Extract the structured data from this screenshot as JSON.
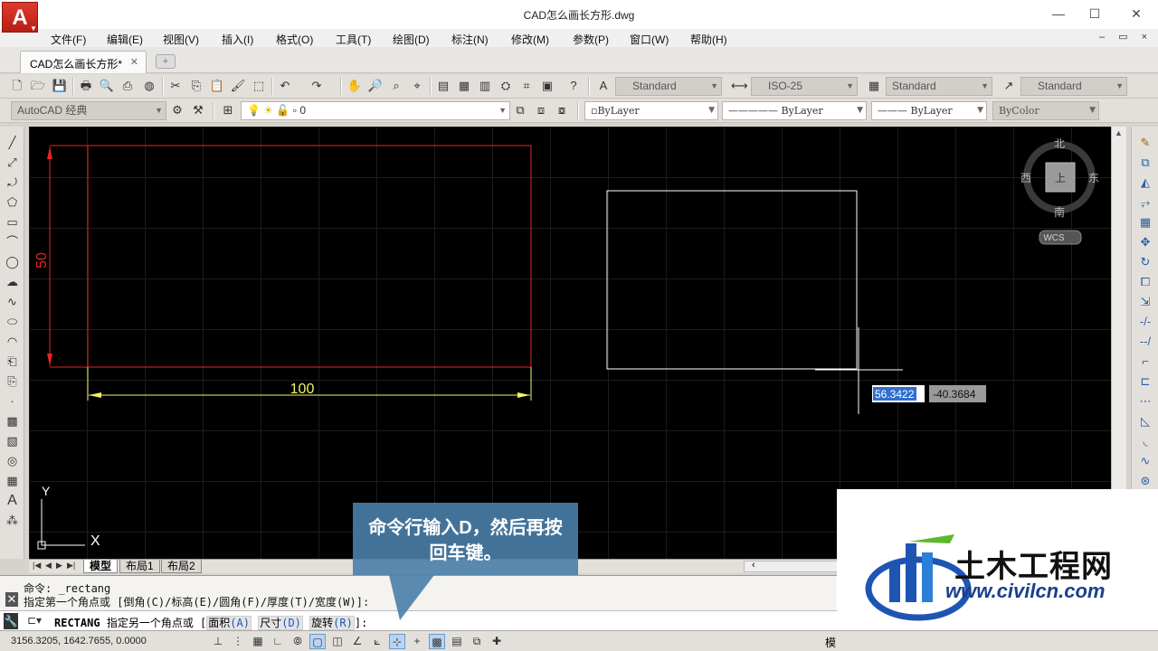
{
  "window": {
    "title": "CAD怎么画长方形.dwg",
    "logo_letter": "A",
    "minimize": "—",
    "maximize": "☐",
    "close": "✕"
  },
  "menu": {
    "items": [
      "文件(F)",
      "编辑(E)",
      "视图(V)",
      "插入(I)",
      "格式(O)",
      "工具(T)",
      "绘图(D)",
      "标注(N)",
      "修改(M)",
      "参数(P)",
      "窗口(W)",
      "帮助(H)"
    ],
    "doc_controls": "– ▭ ×"
  },
  "doc_tab": {
    "label": "CAD怎么画长方形*",
    "close": "✕"
  },
  "toolbar1": {
    "text_style": "Standard",
    "dim_style": "ISO-25",
    "table_style": "Standard",
    "multileader_style": "Standard"
  },
  "toolbar2": {
    "workspace": "AutoCAD 经典",
    "layer": "0",
    "color": "ByLayer",
    "linetype": "ByLayer",
    "lineweight": "ByLayer",
    "plotstyle": "ByColor"
  },
  "canvas": {
    "dim_vertical": "50",
    "dim_horizontal": "100",
    "tooltip_x": "56.3422",
    "tooltip_y": "-40.3684",
    "ucs_y": "Y",
    "ucs_x": "X",
    "viewcube": {
      "north": "北",
      "south": "南",
      "west": "西",
      "east": "东",
      "top": "上",
      "wcs": "WCS"
    }
  },
  "layout_tabs": [
    "模型",
    "布局1",
    "布局2"
  ],
  "command": {
    "history": [
      "命令: _rectang",
      "指定第一个角点或 [倒角(C)/标高(E)/圆角(F)/厚度(T)/宽度(W)]:"
    ],
    "prompt_cmd": "RECTANG",
    "prompt_text": "指定另一个角点或 [",
    "opt1": "面积",
    "opt1_key": "(A)",
    "opt2": "尺寸",
    "opt2_key": "(D)",
    "opt3": "旋转",
    "opt3_key": "(R)",
    "prompt_end": "]:"
  },
  "status": {
    "coords": "3156.3205, 1642.7655, 0.0000",
    "model_label": "模"
  },
  "callout": {
    "line1": "命令行输入D，然后再按",
    "line2": "回车键。"
  },
  "watermark": {
    "title": "土木工程网",
    "url": "www.civilcn.com"
  },
  "colors": {
    "canvas_bg": "#000000",
    "dim_red": "#e8231e",
    "dim_yellow": "#f3f36a",
    "rect_red": "#e8231e",
    "rect_white": "#ffffff",
    "tooltip_sel": "#2f6fd0"
  }
}
